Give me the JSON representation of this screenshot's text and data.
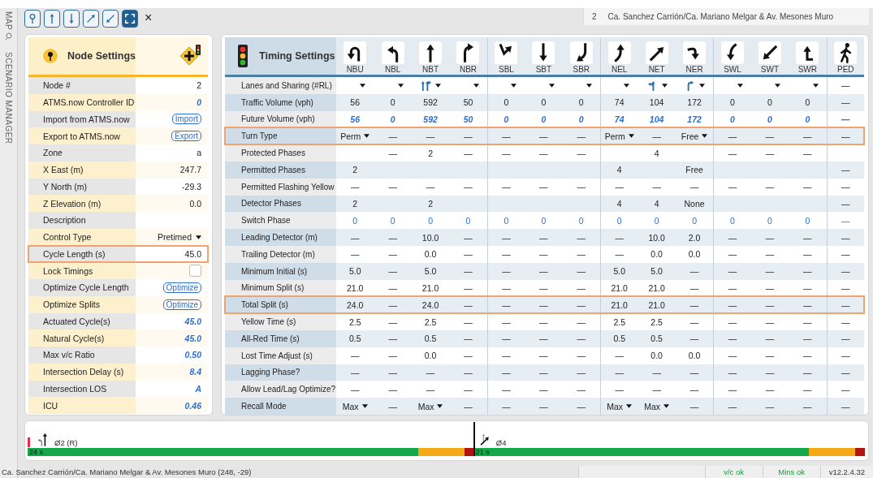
{
  "sidebar": {
    "tabs": [
      {
        "label": "MAP",
        "kind": "search"
      },
      {
        "label": "SCENARIO MANAGER",
        "kind": "plain"
      }
    ]
  },
  "toolbar": {
    "buttons": [
      {
        "kind": "pin",
        "selected": false
      },
      {
        "kind": "up",
        "selected": false
      },
      {
        "kind": "down",
        "selected": false
      },
      {
        "kind": "up-right",
        "selected": false
      },
      {
        "kind": "down-left",
        "selected": false
      },
      {
        "kind": "expand",
        "selected": true
      }
    ],
    "close": "×"
  },
  "location_tab": {
    "node": "2",
    "name": "Ca. Sanchez Carrión/Ca. Mariano Melgar & Av. Mesones Muro"
  },
  "node_settings": {
    "title": "Node Settings",
    "rows": [
      {
        "label": "Node #",
        "kind": "text",
        "value": "2",
        "highlighted": false
      },
      {
        "label": "ATMS.now Controller ID",
        "kind": "computed",
        "value": "0",
        "highlighted": false
      },
      {
        "label": "Import from ATMS.now",
        "kind": "button",
        "value": "Import",
        "highlighted": false
      },
      {
        "label": "Export to ATMS.now",
        "kind": "button",
        "value": "Export",
        "highlighted": false
      },
      {
        "label": "Zone",
        "kind": "text",
        "value": "a",
        "highlighted": false
      },
      {
        "label": "X East (m)",
        "kind": "text",
        "value": "247.7",
        "highlighted": false
      },
      {
        "label": "Y North (m)",
        "kind": "text",
        "value": "-29.3",
        "highlighted": false
      },
      {
        "label": "Z Elevation (m)",
        "kind": "text",
        "value": "0.0",
        "highlighted": false
      },
      {
        "label": "Description",
        "kind": "text",
        "highlighted": false
      },
      {
        "label": "Control Type",
        "kind": "select",
        "value": "Pretimed",
        "highlighted": false
      },
      {
        "label": "Cycle Length (s)",
        "kind": "input",
        "value": "45.0",
        "highlighted": true
      },
      {
        "label": "Lock Timings",
        "kind": "checkbox",
        "checked": false,
        "highlighted": false
      },
      {
        "label": "Optimize Cycle Length",
        "kind": "button",
        "value": "Optimize",
        "highlighted": false
      },
      {
        "label": "Optimize Splits",
        "kind": "button",
        "value": "Optimize",
        "highlighted": false
      },
      {
        "label": "Actuated Cycle(s)",
        "kind": "computed",
        "value": "45.0",
        "highlighted": false
      },
      {
        "label": "Natural Cycle(s)",
        "kind": "computed",
        "value": "45.0",
        "highlighted": false
      },
      {
        "label": "Max v/c Ratio",
        "kind": "computed",
        "value": "0.50",
        "highlighted": false
      },
      {
        "label": "Intersection Delay (s)",
        "kind": "computed",
        "value": "8.4",
        "highlighted": false
      },
      {
        "label": "Intersection LOS",
        "kind": "computed",
        "value": "A",
        "highlighted": false
      },
      {
        "label": "ICU",
        "kind": "computed",
        "value": "0.46",
        "highlighted": false
      }
    ]
  },
  "timing_settings": {
    "title": "Timing Settings",
    "movement_groups": [
      {
        "movements": [
          {
            "label": "NBU",
            "kind": "u-turn"
          },
          {
            "label": "NBL",
            "kind": "left"
          },
          {
            "label": "NBT",
            "kind": "up"
          },
          {
            "label": "NBR",
            "kind": "right"
          }
        ]
      },
      {
        "movements": [
          {
            "label": "SBL",
            "kind": "hook"
          },
          {
            "label": "SBT",
            "kind": "down"
          },
          {
            "label": "SBR",
            "kind": "down-left-curve"
          }
        ]
      },
      {
        "movements": [
          {
            "label": "NEL",
            "kind": "up-curve"
          },
          {
            "label": "NET",
            "kind": "up-right"
          },
          {
            "label": "NER",
            "kind": "down-hook"
          }
        ]
      },
      {
        "movements": [
          {
            "label": "SWL",
            "kind": "down-curve"
          },
          {
            "label": "SWT",
            "kind": "down-left"
          },
          {
            "label": "SWR",
            "kind": "up-hook"
          }
        ]
      },
      {
        "movements": [
          {
            "label": "PED",
            "kind": "pedestrian"
          }
        ]
      }
    ],
    "rows": [
      {
        "label": "Lanes and Sharing (#RL)",
        "kind": "plain",
        "highlighted": false,
        "cells": [
          {
            "kind": "dropdown"
          },
          {
            "kind": "dropdown"
          },
          {
            "kind": "lanes-through-right"
          },
          {
            "kind": "dropdown"
          },
          {
            "kind": "dropdown"
          },
          {
            "kind": "dropdown"
          },
          {
            "kind": "dropdown"
          },
          {
            "kind": "dropdown"
          },
          {
            "kind": "lanes-left-through"
          },
          {
            "kind": "lanes-right"
          },
          {
            "kind": "dropdown"
          },
          {
            "kind": "dropdown"
          },
          {
            "kind": "dropdown"
          },
          "—"
        ]
      },
      {
        "label": "Traffic Volume (vph)",
        "kind": "plain",
        "highlighted": false,
        "cells": [
          "56",
          "0",
          "592",
          "50",
          "0",
          "0",
          "0",
          "74",
          "104",
          "172",
          "0",
          "0",
          "0",
          "—"
        ]
      },
      {
        "label": "Future Volume (vph)",
        "kind": "computed",
        "highlighted": false,
        "cells": [
          "56",
          "0",
          "592",
          "50",
          "0",
          "0",
          "0",
          "74",
          "104",
          "172",
          "0",
          "0",
          "0",
          "—"
        ]
      },
      {
        "label": "Turn Type",
        "kind": "plain",
        "highlighted": true,
        "cells": [
          {
            "kind": "dropdown",
            "value": "Perm"
          },
          "—",
          "—",
          "—",
          "—",
          "—",
          "—",
          {
            "kind": "dropdown",
            "value": "Perm"
          },
          "—",
          {
            "kind": "dropdown",
            "value": "Free"
          },
          "—",
          "—",
          "—",
          "—"
        ]
      },
      {
        "label": "Protected Phases",
        "kind": "plain",
        "highlighted": false,
        "cells": [
          null,
          "—",
          "2",
          "—",
          "—",
          "—",
          "—",
          null,
          "4",
          null,
          "—",
          "—",
          "—",
          null
        ]
      },
      {
        "label": "Permitted Phases",
        "kind": "plain",
        "highlighted": false,
        "cells": [
          "2",
          null,
          null,
          null,
          null,
          null,
          null,
          "4",
          null,
          "Free",
          null,
          null,
          null,
          "—"
        ]
      },
      {
        "label": "Permitted Flashing Yellow",
        "kind": "plain",
        "highlighted": false,
        "cells": [
          "—",
          "—",
          "—",
          "—",
          "—",
          "—",
          "—",
          "—",
          "—",
          "—",
          "—",
          "—",
          "—",
          "—"
        ]
      },
      {
        "label": "Detector Phases",
        "kind": "plain",
        "highlighted": false,
        "cells": [
          "2",
          null,
          "2",
          null,
          null,
          null,
          null,
          "4",
          "4",
          "None",
          null,
          null,
          null,
          "—"
        ]
      },
      {
        "label": "Switch Phase",
        "kind": "link",
        "highlighted": false,
        "cells": [
          "0",
          "0",
          "0",
          "0",
          "0",
          "0",
          "0",
          "0",
          "0",
          "0",
          "0",
          "0",
          "0",
          "—"
        ]
      },
      {
        "label": "Leading Detector (m)",
        "kind": "plain",
        "highlighted": false,
        "cells": [
          "—",
          "—",
          "10.0",
          "—",
          "—",
          "—",
          "—",
          "—",
          "10.0",
          "2.0",
          "—",
          "—",
          "—",
          "—"
        ]
      },
      {
        "label": "Trailing Detector (m)",
        "kind": "plain",
        "highlighted": false,
        "cells": [
          "—",
          "—",
          "0.0",
          "—",
          "—",
          "—",
          "—",
          "—",
          "0.0",
          "0.0",
          "—",
          "—",
          "—",
          "—"
        ]
      },
      {
        "label": "Minimum Initial (s)",
        "kind": "plain",
        "highlighted": false,
        "cells": [
          "5.0",
          "—",
          "5.0",
          "—",
          "—",
          "—",
          "—",
          "5.0",
          "5.0",
          "—",
          "—",
          "—",
          "—",
          "—"
        ]
      },
      {
        "label": "Minimum Split (s)",
        "kind": "plain",
        "highlighted": false,
        "cells": [
          "21.0",
          "—",
          "21.0",
          "—",
          "—",
          "—",
          "—",
          "21.0",
          "21.0",
          "—",
          "—",
          "—",
          "—",
          "—"
        ]
      },
      {
        "label": "Total Split (s)",
        "kind": "plain",
        "highlighted": true,
        "cells": [
          "24.0",
          "—",
          "24.0",
          "—",
          "—",
          "—",
          "—",
          "21.0",
          "21.0",
          "—",
          "—",
          "—",
          "—",
          "—"
        ]
      },
      {
        "label": "Yellow Time (s)",
        "kind": "plain",
        "highlighted": false,
        "cells": [
          "2.5",
          "—",
          "2.5",
          "—",
          "—",
          "—",
          "—",
          "2.5",
          "2.5",
          "—",
          "—",
          "—",
          "—",
          "—"
        ]
      },
      {
        "label": "All-Red Time (s)",
        "kind": "plain",
        "highlighted": false,
        "cells": [
          "0.5",
          "—",
          "0.5",
          "—",
          "—",
          "—",
          "—",
          "0.5",
          "0.5",
          "—",
          "—",
          "—",
          "—",
          "—"
        ]
      },
      {
        "label": "Lost Time Adjust (s)",
        "kind": "plain",
        "highlighted": false,
        "cells": [
          "—",
          "—",
          "0.0",
          "—",
          "—",
          "—",
          "—",
          "—",
          "0.0",
          "0.0",
          "—",
          "—",
          "—",
          "—"
        ]
      },
      {
        "label": "Lagging Phase?",
        "kind": "plain",
        "highlighted": false,
        "cells": [
          "—",
          "—",
          "—",
          "—",
          "—",
          "—",
          "—",
          "—",
          "—",
          "—",
          "—",
          "—",
          "—",
          "—"
        ]
      },
      {
        "label": "Allow Lead/Lag Optimize?",
        "kind": "plain",
        "highlighted": false,
        "cells": [
          "—",
          "—",
          "—",
          "—",
          "—",
          "—",
          "—",
          "—",
          "—",
          "—",
          "—",
          "—",
          "—",
          "—"
        ]
      },
      {
        "label": "Recall Mode",
        "kind": "plain",
        "highlighted": false,
        "cells": [
          {
            "kind": "dropdown",
            "value": "Max"
          },
          "—",
          {
            "kind": "dropdown",
            "value": "Max"
          },
          "—",
          "—",
          "—",
          "—",
          {
            "kind": "dropdown",
            "value": "Max"
          },
          {
            "kind": "dropdown",
            "value": "Max"
          },
          "—",
          "—",
          "—",
          "—",
          "—"
        ]
      }
    ]
  },
  "phase_diagram": {
    "phases": [
      {
        "label": "Ø2 (R)",
        "split": "24 s",
        "kind": "left-through",
        "segments": [
          {
            "kind": "green"
          },
          {
            "kind": "yellow"
          },
          {
            "kind": "red"
          }
        ]
      },
      {
        "label": "Ø4",
        "split": "21 s",
        "kind": "diagonal",
        "segments": [
          {
            "kind": "green"
          },
          {
            "kind": "yellow"
          },
          {
            "kind": "red"
          }
        ]
      }
    ]
  },
  "status_bar": {
    "location": "Ca. Sanchez Carrión/Ca. Mariano Melgar & Av. Mesones Muro (248, -29)",
    "checks": [
      "v/c ok",
      "Mins ok"
    ],
    "version": "v12.2.4.32"
  }
}
